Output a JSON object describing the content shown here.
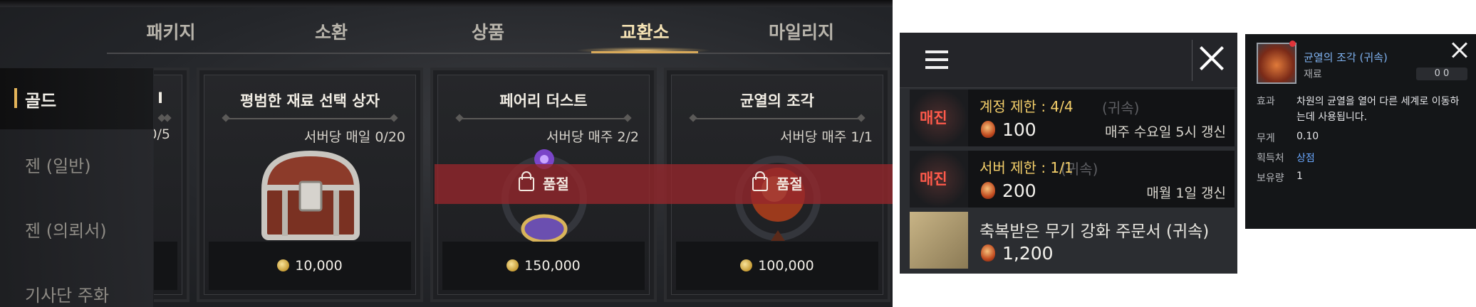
{
  "shop": {
    "tabs": [
      "패키지",
      "소환",
      "상품",
      "교환소",
      "마일리지"
    ],
    "active_tab": "교환소",
    "sidebar": [
      "골드",
      "젠 (일반)",
      "젠 (의뢰서)",
      "기사단 주화"
    ],
    "active_sidebar": "골드",
    "partial_card": {
      "title": "Ⅰ",
      "limit": "0/5"
    },
    "cards": [
      {
        "title": "평범한 재료 선택 상자",
        "limit": "서버당 매일 0/20",
        "price": "10,000",
        "sold_out": false
      },
      {
        "title": "페어리 더스트",
        "limit": "서버당 매주 2/2",
        "price": "150,000",
        "sold_out": true
      },
      {
        "title": "균열의 조각",
        "limit": "서버당 매주 1/1",
        "price": "100,000",
        "sold_out": true
      }
    ],
    "sold_out_label": "품절",
    "colors": {
      "accent": "#d8a95a",
      "sold_out_band": "#96262c"
    }
  },
  "list": {
    "rows": [
      {
        "badge": "매진",
        "limit": "계정 제한 : 4/4",
        "ghost": "(귀속)",
        "price": "100",
        "refresh": "매주 수요일 5시 갱신"
      },
      {
        "badge": "매진",
        "limit": "서버 제한 : 1/1",
        "ghost": "(귀속)",
        "price": "200",
        "refresh": "매월 1일 갱신"
      },
      {
        "title": "축복받은 무기 강화 주문서 (귀속)",
        "price": "1,200"
      }
    ]
  },
  "tooltip": {
    "name": "균열의 조각 (귀속)",
    "type": "재료",
    "stats": "0  0",
    "labels": [
      "효과",
      "무게",
      "획득처",
      "보유량"
    ],
    "effect": "차원의 균열을 열어 다른 세계로 이동하는데 사용됩니다.",
    "weight": "0.10",
    "source": "상점",
    "owned": "1"
  }
}
